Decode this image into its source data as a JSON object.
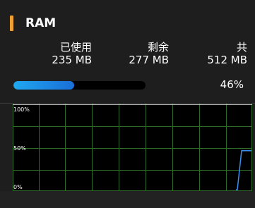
{
  "panel": {
    "title": "RAM",
    "accent_color": "#f0a030"
  },
  "stats": {
    "used_label": "已使用",
    "used_value": "235 MB",
    "free_label": "剩余",
    "free_value": "277 MB",
    "total_label": "共",
    "total_value": "512 MB"
  },
  "usage": {
    "percent_text": "46%",
    "percent": 46
  },
  "graph": {
    "y_labels": [
      "100%",
      "50%",
      "0%"
    ],
    "line_color": "#3a8ff0",
    "grid_color": "#2e6b2a",
    "points_percent": [
      0,
      0,
      46,
      46
    ]
  }
}
